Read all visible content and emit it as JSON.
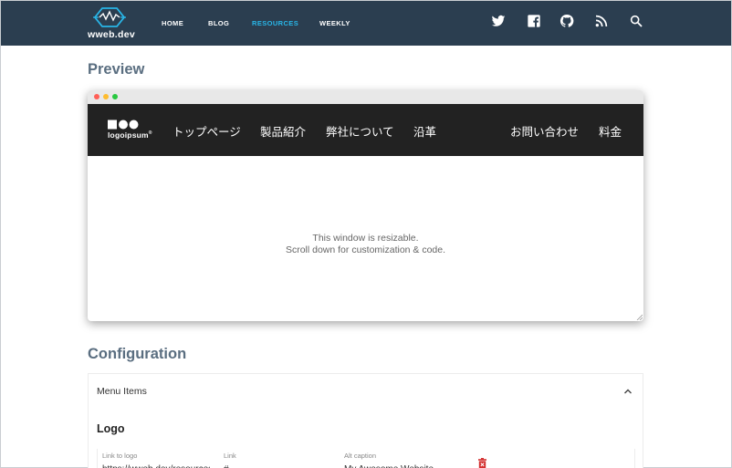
{
  "site": {
    "brand": "wweb.dev",
    "nav": [
      {
        "label": "HOME"
      },
      {
        "label": "BLOG"
      },
      {
        "label": "RESOURCES"
      },
      {
        "label": "WEEKLY"
      }
    ],
    "icons": [
      "twitter-icon",
      "facebook-icon",
      "github-icon",
      "rss-icon",
      "search-icon"
    ],
    "active_color": "#29b6e8",
    "nav_bg": "#2b3e50"
  },
  "preview": {
    "title": "Preview",
    "window": {
      "logo_text": "logoipsum",
      "logo_mark": "®",
      "menu_left": [
        "トップページ",
        "製品紹介",
        "弊社について",
        "沿革"
      ],
      "menu_right": [
        "お問い合わせ",
        "料金"
      ],
      "message_line1": "This window is resizable.",
      "message_line2": "Scroll down for customization & code.",
      "header_bg": "#222222"
    }
  },
  "configuration": {
    "title": "Configuration",
    "accordion_label": "Menu Items",
    "group_title": "Logo",
    "fields": {
      "link_to_logo_label": "Link to logo",
      "link_to_logo_value": "https://wweb.dev/resources",
      "link_label": "Link",
      "link_value": "#",
      "alt_caption_label": "Alt caption",
      "alt_caption_value": "My Awesome Website"
    }
  }
}
